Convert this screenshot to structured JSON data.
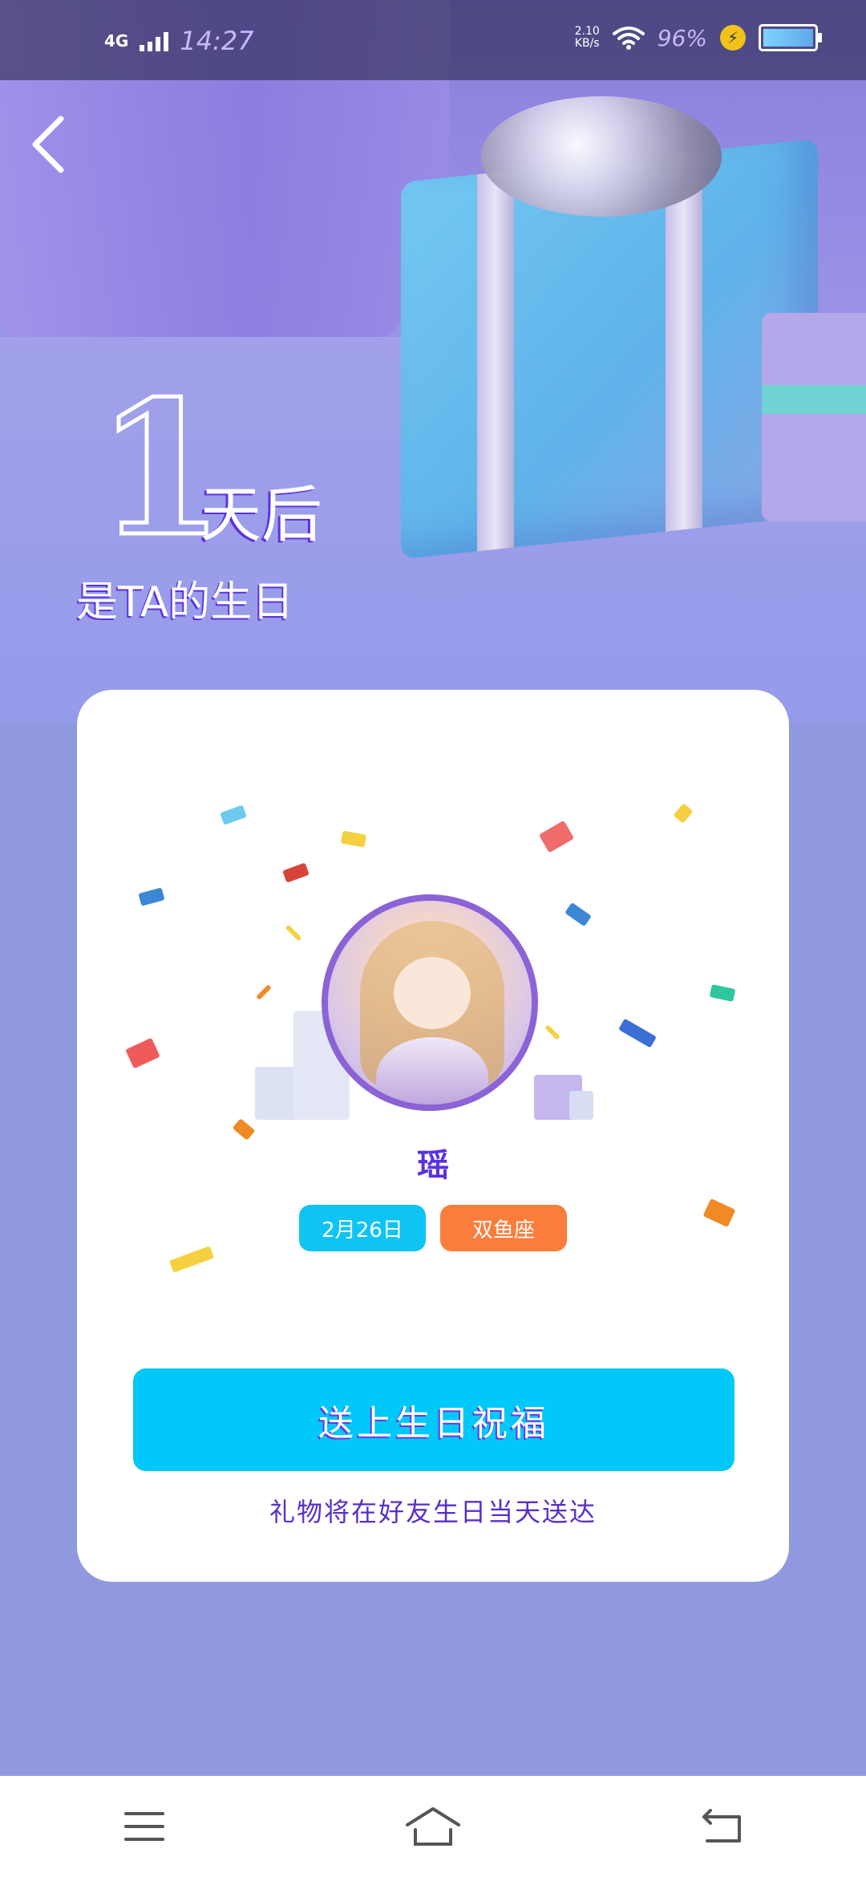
{
  "status_bar": {
    "network": "4G",
    "time": "14:27",
    "speed_value": "2.10",
    "speed_unit": "KB/s",
    "battery_percent": "96%"
  },
  "countdown": {
    "number": "1",
    "unit": "天后",
    "subtitle": "是TA的生日"
  },
  "profile": {
    "name": "瑶",
    "birthday": "2月26日",
    "zodiac": "双鱼座"
  },
  "actions": {
    "send_label": "送上生日祝福",
    "note": "礼物将在好友生日当天送达"
  },
  "colors": {
    "accent_purple": "#5a31e0",
    "cta_blue": "#00c8f8",
    "date_tag": "#0fc4f5",
    "zodiac_tag": "#fb7d3b",
    "page_bg": "#9099e0"
  },
  "icons": {
    "back": "chevron-left-icon",
    "menu": "menu-icon",
    "home": "home-icon",
    "return": "return-icon"
  }
}
